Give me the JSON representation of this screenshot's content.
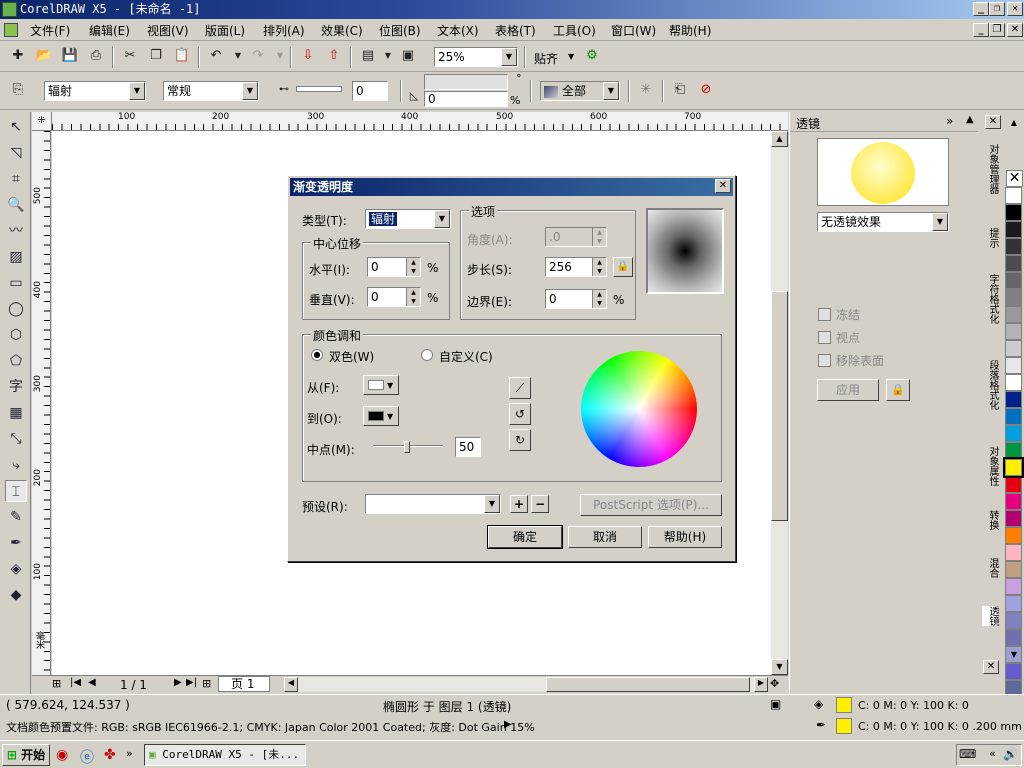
{
  "window": {
    "title": "CorelDRAW X5 - [未命名 -1]"
  },
  "menu": [
    "文件(F)",
    "编辑(E)",
    "视图(V)",
    "版面(L)",
    "排列(A)",
    "效果(C)",
    "位图(B)",
    "文本(X)",
    "表格(T)",
    "工具(O)",
    "窗口(W)",
    "帮助(H)"
  ],
  "toolbar": {
    "zoom": "25%",
    "snap_label": "贴齐"
  },
  "propbar": {
    "type_value": "辐射",
    "mode_value": "常规",
    "opacity_value": "0",
    "angle_value": "0",
    "apply_to_value": "全部",
    "percent_sign": "%",
    "degree_sign": "°"
  },
  "ruler": {
    "h_labels": [
      "100",
      "200",
      "300",
      "400",
      "500",
      "600",
      "700"
    ],
    "v_labels": [
      "500",
      "400",
      "300",
      "200",
      "100"
    ],
    "unit": "毫米"
  },
  "pagebar": {
    "page_count": "1 / 1",
    "page_tab": "页 1"
  },
  "dialog": {
    "title": "渐变透明度",
    "type_label": "类型(T):",
    "type_value": "辐射",
    "offset_group": "中心位移",
    "h_label": "水平(I):",
    "h_value": "0",
    "v_label": "垂直(V):",
    "v_value": "0",
    "options_group": "选项",
    "angle_label": "角度(A):",
    "angle_value": ".0",
    "steps_label": "步长(S):",
    "steps_value": "256",
    "edge_label": "边界(E):",
    "edge_value": "0",
    "percent": "%",
    "blend_group": "颜色调和",
    "two_color_label": "双色(W)",
    "custom_label": "自定义(C)",
    "from_label": "从(F):",
    "to_label": "到(O):",
    "mid_label": "中点(M):",
    "mid_value": "50",
    "preset_label": "预设(R):",
    "postscript_label": "PostScript 选项(P)...",
    "ok_label": "确定",
    "cancel_label": "取消",
    "help_label": "帮助(H)"
  },
  "docker": {
    "title": "透镜",
    "lens_value": "无透镜效果",
    "freeze_label": "冻结",
    "viewpoint_label": "视点",
    "remove_face_label": "移除表面",
    "apply_label": "应用",
    "tabs": [
      "对象管理器",
      "提示",
      "字符格式化",
      "段落格式化",
      "对象属性",
      "转换",
      "混合",
      "透镜"
    ]
  },
  "palette": {
    "colors": [
      "#ffffff",
      "#000000",
      "#1a1a1a",
      "#333333",
      "#4d4d4d",
      "#666666",
      "#808080",
      "#999999",
      "#b3b3b3",
      "#cccccc",
      "#e6e6e6",
      "#ffffff",
      "#00208c",
      "#0070c0",
      "#00a0e0",
      "#009640",
      "#fff000",
      "#e60012",
      "#e4007f",
      "#b4006e",
      "#ff7f00",
      "#ffb6c1",
      "#c0a080",
      "#c8a0e0",
      "#a0a0e0",
      "#8080c0",
      "#7070b0",
      "#a0a0d0",
      "#6a5acd",
      "#5a6a9a"
    ]
  },
  "status": {
    "coords": "( 579.624, 124.537 )",
    "object_info": "椭圆形 于 图层 1 (透镜)",
    "color_profile": "文档颜色预置文件: RGB: sRGB IEC61966-2.1; CMYK: Japan Color 2001 Coated; 灰度: Dot Gain 15%",
    "fill_info": "C: 0 M: 0 Y: 100 K: 0",
    "outline_info": "C: 0 M: 0 Y: 100 K: 0  .200 mm"
  },
  "taskbar": {
    "start_label": "开始",
    "task_label": "CorelDRAW X5 - [未..."
  }
}
